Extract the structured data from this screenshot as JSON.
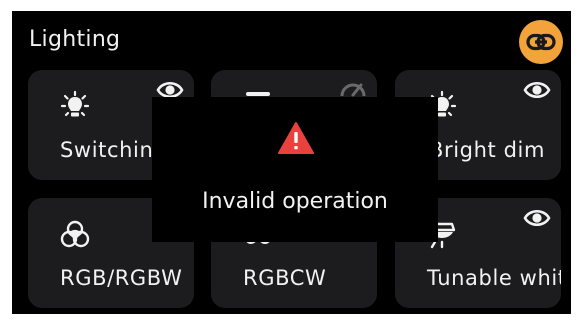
{
  "header": {
    "title": "Lighting"
  },
  "colors": {
    "accent": "#f2a33a",
    "warning": "#e8413e",
    "card": "#1c1c1e",
    "text": "#f2f2f2"
  },
  "cards": [
    {
      "label": "Switching",
      "icon": "bulb-icon",
      "badge": "eye-icon"
    },
    {
      "label": "",
      "icon": "dash-icon",
      "badge": "gauge-icon"
    },
    {
      "label": "Bright dim",
      "icon": "bulb-icon",
      "badge": "eye-icon"
    },
    {
      "label": "RGB/RGBW",
      "icon": "rgb-color-icon",
      "badge": ""
    },
    {
      "label": "RGBCW",
      "icon": "rgbcw-icon",
      "badge": ""
    },
    {
      "label": "Tunable white",
      "icon": "ceiling-lamp-icon",
      "badge": "eye-icon"
    }
  ],
  "toast": {
    "message": "Invalid operation",
    "icon": "warning-icon"
  }
}
